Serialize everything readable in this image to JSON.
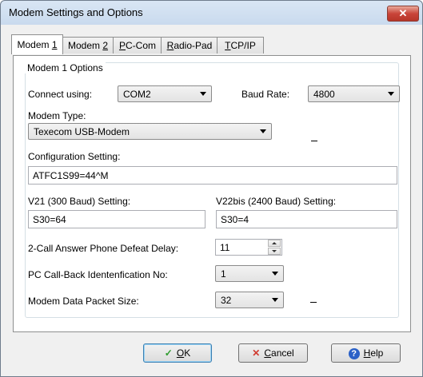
{
  "window": {
    "title": "Modem Settings and Options",
    "close_label": "✕"
  },
  "tabs": [
    {
      "pre": "Modem ",
      "key": "1",
      "post": ""
    },
    {
      "pre": "Modem ",
      "key": "2",
      "post": ""
    },
    {
      "pre": "",
      "key": "P",
      "post": "C-Com"
    },
    {
      "pre": "",
      "key": "R",
      "post": "adio-Pad"
    },
    {
      "pre": "",
      "key": "T",
      "post": "CP/IP"
    }
  ],
  "group": {
    "title": "Modem 1 Options"
  },
  "fields": {
    "connect_label": "Connect using:",
    "connect_value": "COM2",
    "baud_label": "Baud Rate:",
    "baud_value": "4800",
    "modem_type_label": "Modem Type:",
    "modem_type_value": "Texecom USB-Modem",
    "config_label": "Configuration Setting:",
    "config_value": "ATFC1S99=44^M",
    "v21_label": "V21 (300 Baud) Setting:",
    "v21_value": "S30=64",
    "v22_label": "V22bis (2400 Baud) Setting:",
    "v22_value": "S30=4",
    "delay_label": "2-Call Answer Phone Defeat Delay:",
    "delay_value": "11",
    "callback_label": "PC Call-Back Identenfication No:",
    "callback_value": "1",
    "packet_label": "Modem Data Packet Size:",
    "packet_value": "32"
  },
  "buttons": {
    "ok": {
      "key": "O",
      "rest": "K",
      "icon": "✓"
    },
    "cancel": {
      "key": "C",
      "rest": "ancel",
      "icon": "✕"
    },
    "help": {
      "key": "H",
      "rest": "elp",
      "icon": "?"
    }
  },
  "colors": {
    "ok_icon": "#2e9b2e",
    "cancel_icon": "#d03a2f",
    "help_icon": "#2b61c7"
  }
}
